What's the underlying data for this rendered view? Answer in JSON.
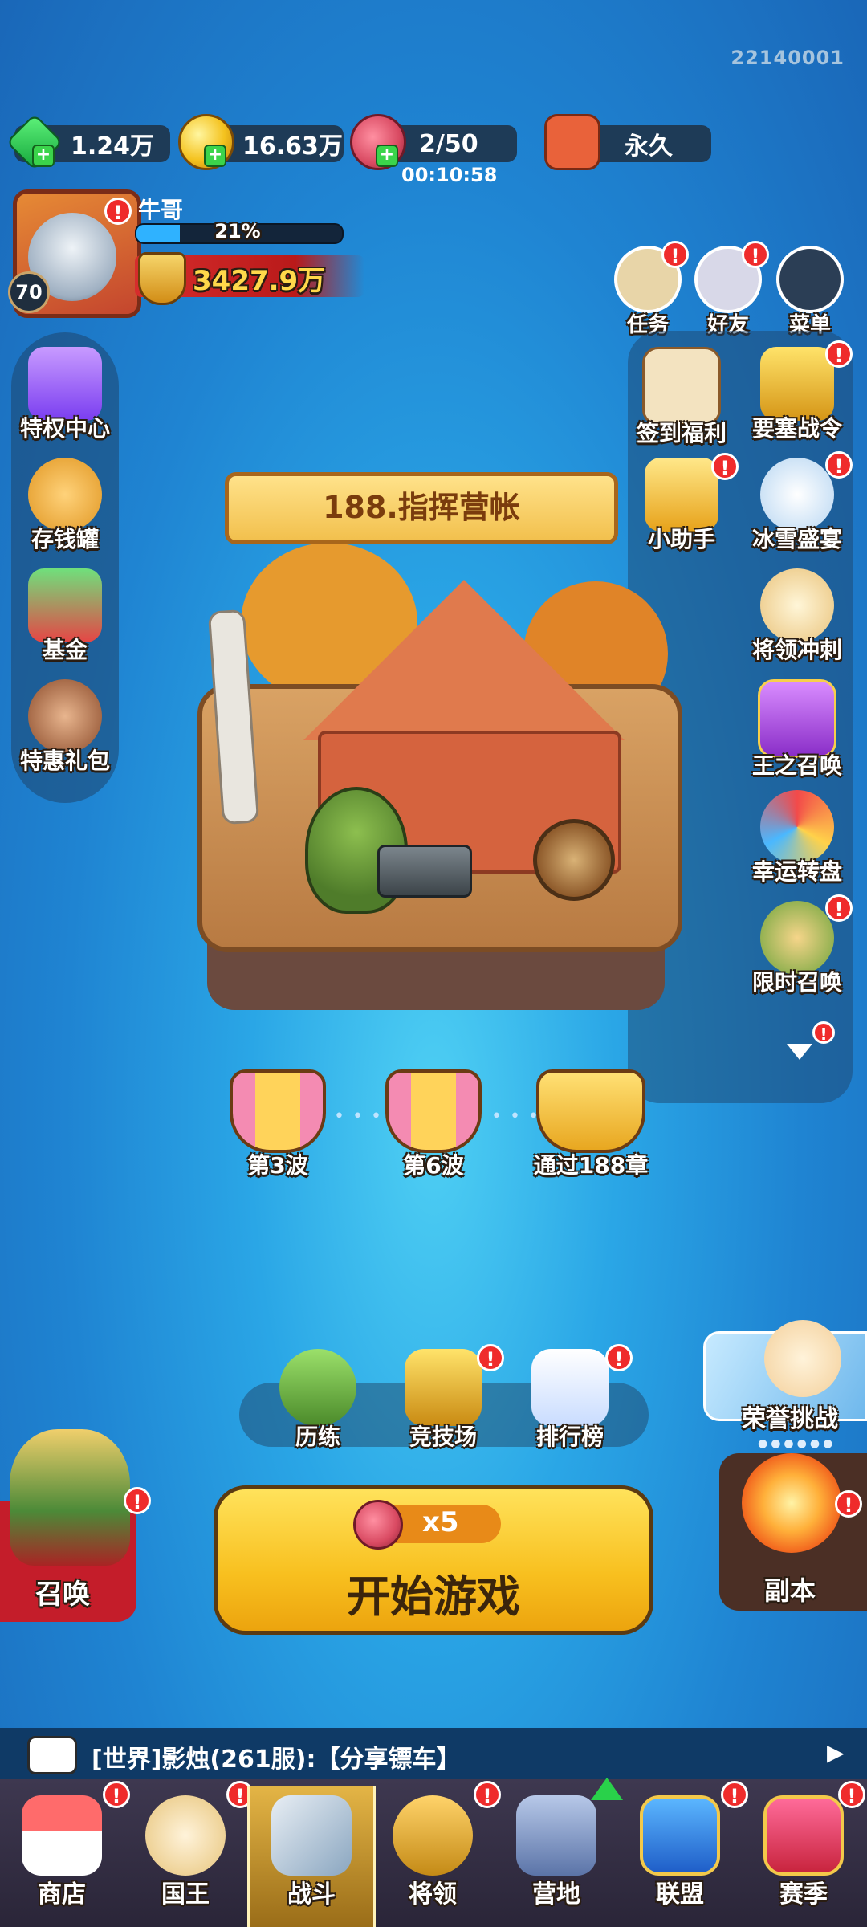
{
  "build_id": "22140001",
  "resources": [
    {
      "name": "gems",
      "value": "1.24万",
      "icon": "gem-icon"
    },
    {
      "name": "coins",
      "value": "16.63万",
      "icon": "coin-icon"
    },
    {
      "name": "stamina",
      "value": "2/50",
      "icon": "meat-icon"
    },
    {
      "name": "ad_pass",
      "value": "永久",
      "icon": "tv-icon"
    }
  ],
  "stamina_timer": "00:10:58",
  "player": {
    "name": "牛哥",
    "level": "70",
    "xp_percent": "21%",
    "xp_fraction": 0.21,
    "power": "3427.9万"
  },
  "top_right": [
    {
      "label": "任务",
      "icon": "quest-scroll-icon",
      "badge": "!"
    },
    {
      "label": "好友",
      "icon": "friends-icon",
      "badge": "!"
    },
    {
      "label": "菜单",
      "icon": "menu-icon",
      "badge": ""
    }
  ],
  "left_menu": [
    {
      "label": "特权中心",
      "icon": "privilege-card-icon"
    },
    {
      "label": "存钱罐",
      "icon": "piggy-bank-icon"
    },
    {
      "label": "基金",
      "icon": "fund-chart-icon"
    },
    {
      "label": "特惠礼包",
      "icon": "gift-pack-icon"
    }
  ],
  "right_menu": [
    {
      "label": "签到福利",
      "icon": "calendar-icon",
      "badge": ""
    },
    {
      "label": "要塞战令",
      "icon": "treasure-chest-icon",
      "badge": "!"
    },
    {
      "label": "小助手",
      "icon": "vip-icon",
      "badge": "!"
    },
    {
      "label": "冰雪盛宴",
      "icon": "snowman-icon",
      "badge": "!"
    },
    {
      "label": "将领冲刺",
      "icon": "hero-sprint-icon",
      "badge": ""
    },
    {
      "label": "王之召唤",
      "icon": "king-chest-icon",
      "badge": ""
    },
    {
      "label": "幸运转盘",
      "icon": "lucky-wheel-icon",
      "badge": ""
    },
    {
      "label": "限时召唤",
      "icon": "limited-summon-icon",
      "badge": "!"
    }
  ],
  "stage": {
    "title": "188.指挥营帐"
  },
  "milestones": [
    {
      "label": "第3波"
    },
    {
      "label": "第6波"
    },
    {
      "label": "通过188章"
    }
  ],
  "modes": [
    {
      "label": "历练",
      "icon": "training-arrows-icon",
      "badge": ""
    },
    {
      "label": "竞技场",
      "icon": "arena-crown-icon",
      "badge": "!"
    },
    {
      "label": "排行榜",
      "icon": "leaderboard-podium-icon",
      "badge": "!"
    }
  ],
  "honor_challenge": {
    "label": "荣誉挑战"
  },
  "dungeon": {
    "label": "副本"
  },
  "summon": {
    "label": "召唤"
  },
  "start": {
    "cost": "x5",
    "label": "开始游戏"
  },
  "chat": {
    "text": "[世界]影烛(261服):【分享镖车】"
  },
  "nav": [
    {
      "label": "商店",
      "icon": "shop-icon",
      "badge": "!"
    },
    {
      "label": "国王",
      "icon": "king-icon",
      "badge": "!"
    },
    {
      "label": "战斗",
      "icon": "battle-sword-icon",
      "badge": ""
    },
    {
      "label": "将领",
      "icon": "general-helmet-icon",
      "badge": "!"
    },
    {
      "label": "营地",
      "icon": "castle-icon",
      "badge": ""
    },
    {
      "label": "联盟",
      "icon": "alliance-shield-icon",
      "badge": "!"
    },
    {
      "label": "赛季",
      "icon": "season-badge-icon",
      "badge": "!"
    }
  ],
  "colors": {
    "accent_yellow": "#f8c01f",
    "badge_red": "#ef2b2b",
    "nav_active": "#e4b546"
  }
}
